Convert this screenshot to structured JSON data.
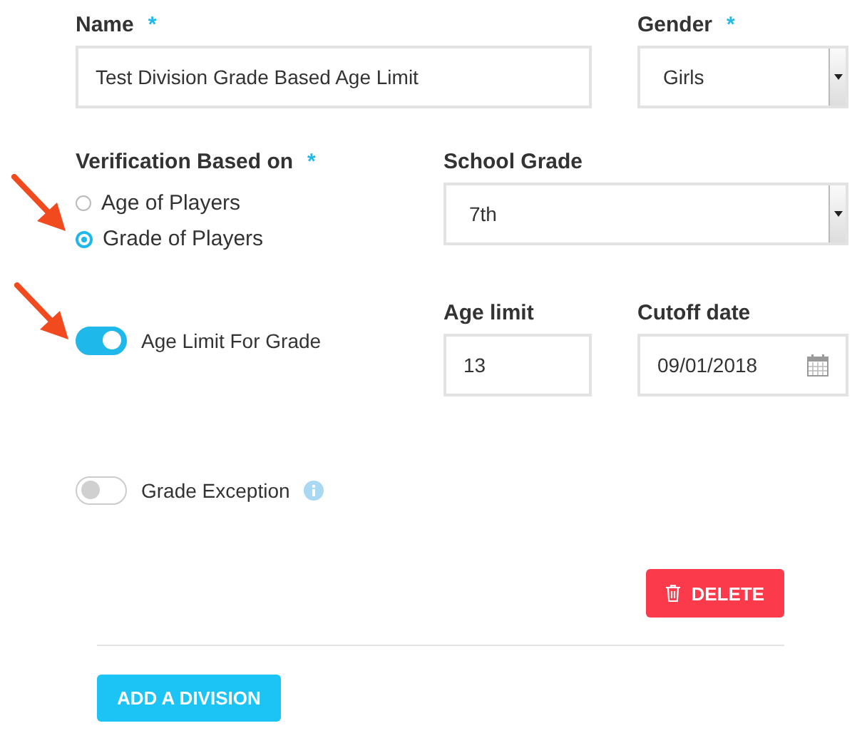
{
  "name": {
    "label": "Name",
    "required_mark": "*",
    "value": "Test Division Grade Based Age Limit"
  },
  "gender": {
    "label": "Gender",
    "required_mark": "*",
    "value": "Girls"
  },
  "verification": {
    "label": "Verification Based on",
    "required_mark": "*",
    "options": [
      {
        "label": "Age of Players",
        "selected": false
      },
      {
        "label": "Grade of Players",
        "selected": true
      }
    ]
  },
  "school_grade": {
    "label": "School Grade",
    "value": "7th"
  },
  "toggles": [
    {
      "label": "Age Limit For Grade",
      "on": true,
      "info": false
    },
    {
      "label": "Grade Exception",
      "on": false,
      "info": true
    }
  ],
  "age_limit": {
    "label": "Age limit",
    "value": "13"
  },
  "cutoff_date": {
    "label": "Cutoff date",
    "value": "09/01/2018"
  },
  "buttons": [
    {
      "label": "DELETE",
      "kind": "delete"
    },
    {
      "label": "ADD A DIVISION",
      "kind": "add"
    }
  ]
}
